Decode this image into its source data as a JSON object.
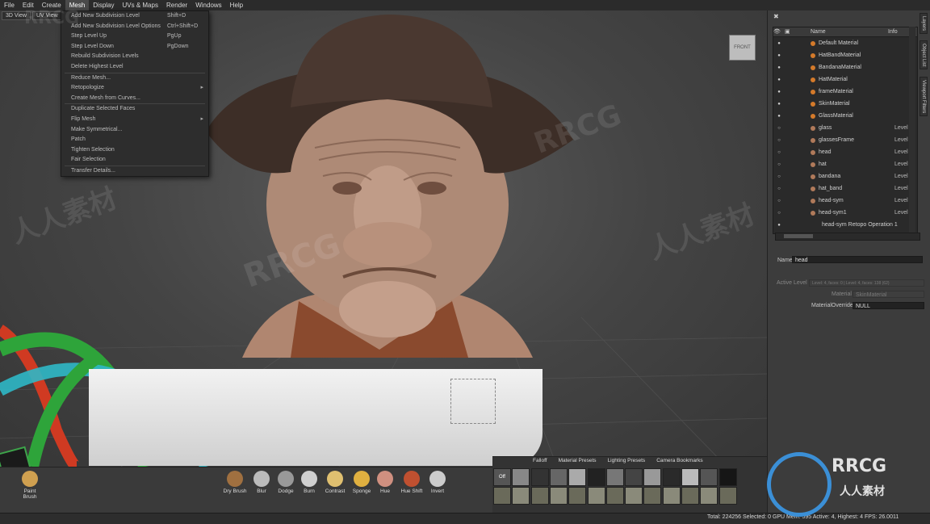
{
  "menubar": {
    "items": [
      "File",
      "Edit",
      "Create",
      "Mesh",
      "Display",
      "UVs & Maps",
      "Render",
      "Windows",
      "Help"
    ],
    "active": "Mesh"
  },
  "viewport": {
    "tabs": [
      "3D View",
      "UV View"
    ],
    "view_cube_label": "FRONT"
  },
  "mesh_menu": {
    "items": [
      {
        "label": "Add New Subdivision Level",
        "shortcut": "Shift+D"
      },
      {
        "label": "Add New Subdivision Level Options",
        "shortcut": "Ctrl+Shift+D"
      },
      {
        "label": "Step Level Up",
        "shortcut": "PgUp"
      },
      {
        "label": "Step Level Down",
        "shortcut": "PgDown"
      },
      {
        "label": "Rebuild Subdivision Levels",
        "shortcut": ""
      },
      {
        "label": "Delete Highest Level",
        "shortcut": ""
      },
      {
        "label": "Reduce Mesh...",
        "shortcut": ""
      },
      {
        "label": "Retopologize",
        "shortcut": ""
      },
      {
        "label": "Create Mesh from Curves...",
        "shortcut": ""
      },
      {
        "label": "Duplicate Selected Faces",
        "shortcut": ""
      },
      {
        "label": "Flip Mesh",
        "shortcut": ""
      },
      {
        "label": "Make Symmetrical...",
        "shortcut": ""
      },
      {
        "label": "Patch",
        "shortcut": ""
      },
      {
        "label": "Tighten Selection",
        "shortcut": ""
      },
      {
        "label": "Fair Selection",
        "shortcut": ""
      },
      {
        "label": "Transfer Details...",
        "shortcut": ""
      }
    ]
  },
  "outliner": {
    "col_name": "Name",
    "col_info": "Info",
    "rows": [
      {
        "name": "Default Material",
        "info": ""
      },
      {
        "name": "HatBandMaterial",
        "info": ""
      },
      {
        "name": "BandanaMaterial",
        "info": ""
      },
      {
        "name": "HatMaterial",
        "info": ""
      },
      {
        "name": "frameMaterial",
        "info": ""
      },
      {
        "name": "SkinMaterial",
        "info": ""
      },
      {
        "name": "GlassMaterial",
        "info": ""
      },
      {
        "name": "glass",
        "info": "Level"
      },
      {
        "name": "glassesFrame",
        "info": "Level"
      },
      {
        "name": "head",
        "info": "Level"
      },
      {
        "name": "hat",
        "info": "Level"
      },
      {
        "name": "bandana",
        "info": "Level"
      },
      {
        "name": "hat_band",
        "info": "Level"
      },
      {
        "name": "head-sym",
        "info": "Level"
      },
      {
        "name": "head-sym1",
        "info": "Level"
      },
      {
        "name": "head-sym Retopo Operation 1",
        "info": ""
      }
    ]
  },
  "side_tabs": [
    "Layers",
    "Object List",
    "Viewport Filters"
  ],
  "properties": {
    "name_label": "Name",
    "name_value": "head",
    "active_level_label": "Active Level",
    "active_level_value": "Level: 4, faces: 0 | Level: 4, faces: 138 (62)",
    "material_label": "Material",
    "material_value": "SkinMaterial",
    "material_override_label": "MaterialOverride",
    "material_override_value": "NULL"
  },
  "brushes": [
    "Paint Brush",
    "Dry Brush",
    "Blur",
    "Dodge",
    "Burn",
    "Contrast",
    "Sponge",
    "Hue",
    "Hue Shift",
    "Invert"
  ],
  "stamp_tabs": [
    "Falloff",
    "Material Presets",
    "Lighting Presets",
    "Camera Bookmarks"
  ],
  "stamp_off_label": "Off",
  "status": "Total: 224256  Selected: 0  GPU Mem: 595  Active: 4, Highest: 4  FPS: 26.0011",
  "watermarks": [
    "RRCG",
    "人人素材"
  ],
  "colors": {
    "material_dot": "#d47a2a",
    "panel_bg": "#3c3c3c",
    "menu_bg": "#2d2d2d"
  }
}
